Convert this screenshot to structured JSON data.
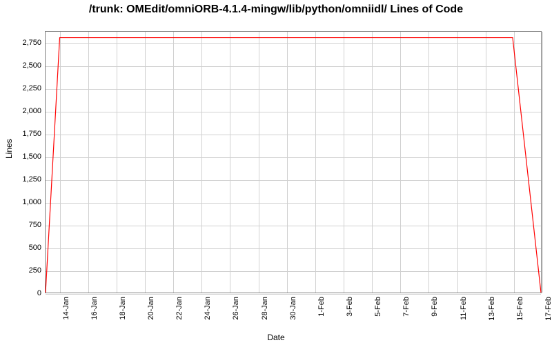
{
  "chart_data": {
    "type": "line",
    "title": "/trunk: OMEdit/omniORB-4.1.4-mingw/lib/python/omniidl/ Lines of Code",
    "xlabel": "Date",
    "ylabel": "Lines",
    "ylim": [
      0,
      2875
    ],
    "yticks": [
      0,
      250,
      500,
      750,
      1000,
      1250,
      1500,
      1750,
      2000,
      2250,
      2500,
      2750
    ],
    "xticks": [
      "14-Jan",
      "16-Jan",
      "18-Jan",
      "20-Jan",
      "22-Jan",
      "24-Jan",
      "26-Jan",
      "28-Jan",
      "30-Jan",
      "1-Feb",
      "3-Feb",
      "5-Feb",
      "7-Feb",
      "9-Feb",
      "11-Feb",
      "13-Feb",
      "15-Feb",
      "17-Feb"
    ],
    "x_range": [
      "13-Jan",
      "17-Feb"
    ],
    "series": [
      {
        "name": "lines-of-code",
        "color": "#ff0000",
        "x": [
          "13-Jan",
          "14-Jan",
          "16-Jan",
          "18-Jan",
          "20-Jan",
          "22-Jan",
          "24-Jan",
          "26-Jan",
          "28-Jan",
          "30-Jan",
          "1-Feb",
          "3-Feb",
          "5-Feb",
          "7-Feb",
          "9-Feb",
          "11-Feb",
          "13-Feb",
          "15-Feb",
          "17-Feb"
        ],
        "y": [
          0,
          2810,
          2810,
          2810,
          2810,
          2810,
          2810,
          2810,
          2810,
          2810,
          2810,
          2810,
          2810,
          2810,
          2810,
          2810,
          2810,
          2810,
          0
        ]
      }
    ]
  }
}
